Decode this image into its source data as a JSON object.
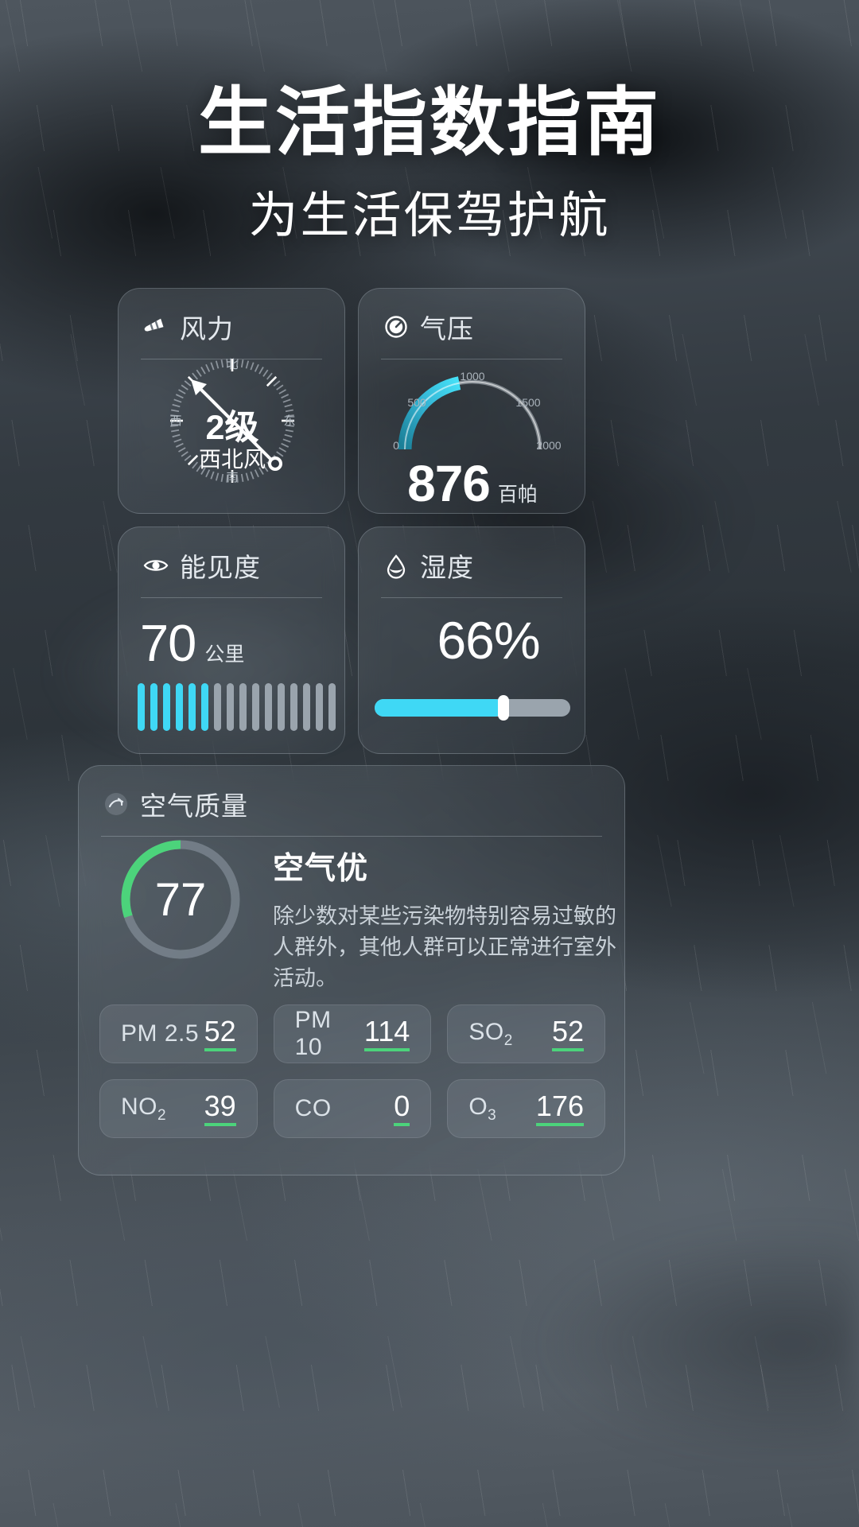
{
  "header": {
    "title": "生活指数指南",
    "subtitle": "为生活保驾护航"
  },
  "colors": {
    "accent_cyan": "#3fd8f5",
    "accent_green": "#4cd37b",
    "text_primary": "#ffffff",
    "text_secondary": "#c9d1d8"
  },
  "cards": {
    "wind": {
      "title": "风力",
      "icon": "windsock-icon",
      "value": "2级",
      "direction": "西北风",
      "compass_labels": {
        "north": "北",
        "south": "南",
        "east": "东",
        "west": "西"
      }
    },
    "pressure": {
      "title": "气压",
      "icon": "gauge-icon",
      "value": "876",
      "unit": "百帕",
      "ticks": [
        "0",
        "500",
        "1000",
        "1500",
        "2000"
      ],
      "range_max": 2000
    },
    "visibility": {
      "title": "能见度",
      "icon": "eye-icon",
      "value": "70",
      "unit": "公里",
      "bars_total": 16,
      "bars_active": 6
    },
    "humidity": {
      "title": "湿度",
      "icon": "droplet-icon",
      "value": "66%",
      "percent": 66
    },
    "air_quality": {
      "title": "空气质量",
      "icon": "air-quality-icon",
      "aqi": "77",
      "aqi_percent": 30,
      "level": "空气优",
      "description": "除少数对某些污染物特别容易过敏的人群外，其他人群可以正常进行室外活动。",
      "pollutants": [
        {
          "name": "PM 2.5",
          "sub": "",
          "value": "52"
        },
        {
          "name": "PM 10",
          "sub": "",
          "value": "114"
        },
        {
          "name": "SO",
          "sub": "2",
          "value": "52"
        },
        {
          "name": "NO",
          "sub": "2",
          "value": "39"
        },
        {
          "name": "CO",
          "sub": "",
          "value": "0"
        },
        {
          "name": "O",
          "sub": "3",
          "value": "176"
        }
      ]
    }
  }
}
